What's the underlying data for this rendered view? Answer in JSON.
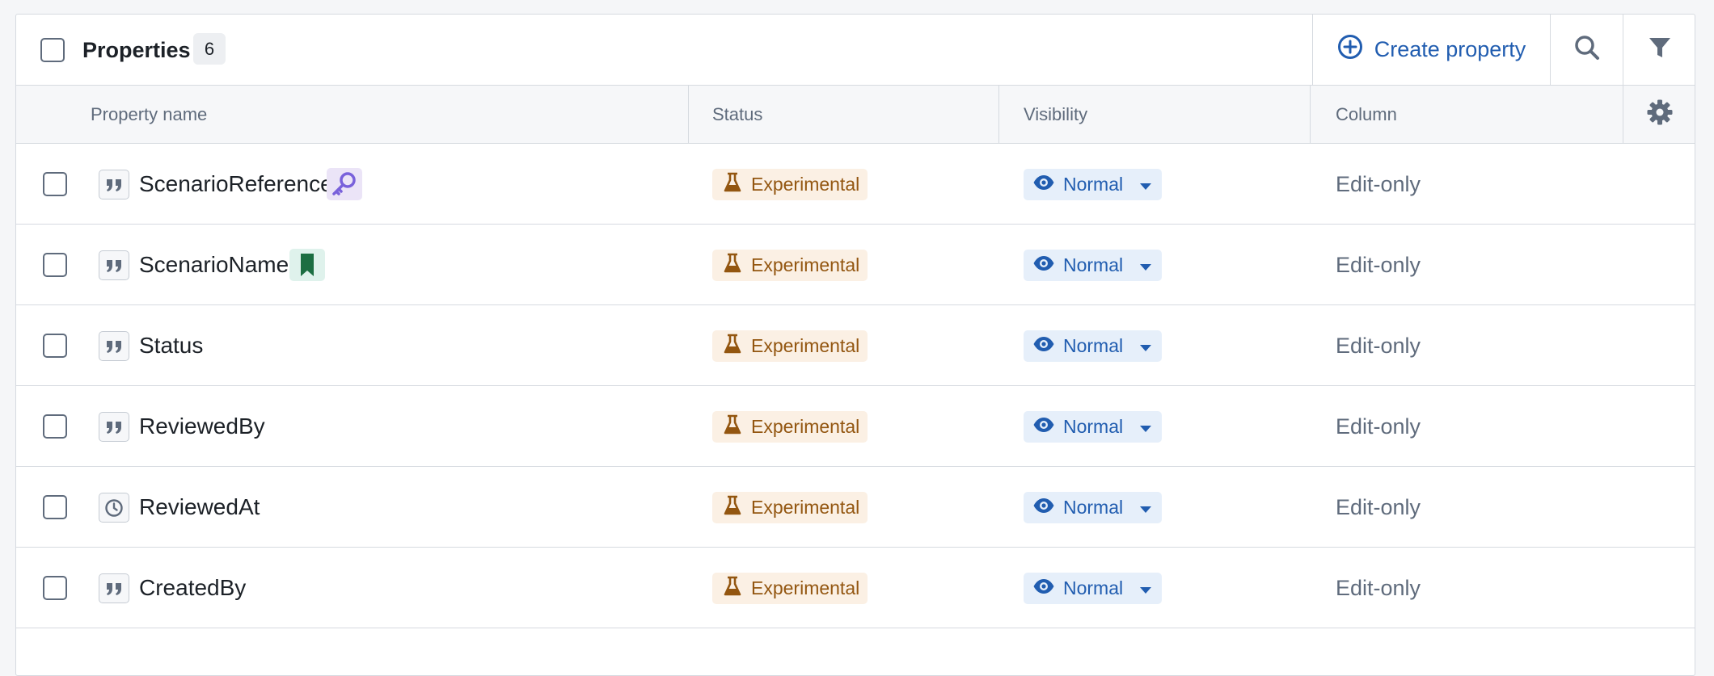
{
  "toolbar": {
    "title": "Properties",
    "count": "6",
    "create_label": "Create property",
    "search_icon": "search-icon",
    "filter_icon": "filter-icon"
  },
  "columns": {
    "name": "Property name",
    "status": "Status",
    "visibility": "Visibility",
    "column": "Column",
    "settings_icon": "gear-icon"
  },
  "colors": {
    "accent": "#215db0",
    "status_bg": "#fbf0e4",
    "status_fg": "#935610",
    "visibility_bg": "#e6effa",
    "primary_key_bg": "#ebe4f7",
    "primary_key_fg": "#7961db",
    "title_key_bg": "#dff2ec",
    "title_key_fg": "#1c6e42"
  },
  "rows": [
    {
      "name": "ScenarioReference",
      "type_icon": "string-quote-icon",
      "extra_icon": "key-icon",
      "status": "Experimental",
      "visibility": "Normal",
      "column": "Edit-only"
    },
    {
      "name": "ScenarioName",
      "type_icon": "string-quote-icon",
      "extra_icon": "bookmark-icon",
      "status": "Experimental",
      "visibility": "Normal",
      "column": "Edit-only"
    },
    {
      "name": "Status",
      "type_icon": "string-quote-icon",
      "extra_icon": "",
      "status": "Experimental",
      "visibility": "Normal",
      "column": "Edit-only"
    },
    {
      "name": "ReviewedBy",
      "type_icon": "string-quote-icon",
      "extra_icon": "",
      "status": "Experimental",
      "visibility": "Normal",
      "column": "Edit-only"
    },
    {
      "name": "ReviewedAt",
      "type_icon": "timestamp-clock-icon",
      "extra_icon": "",
      "status": "Experimental",
      "visibility": "Normal",
      "column": "Edit-only"
    },
    {
      "name": "CreatedBy",
      "type_icon": "string-quote-icon",
      "extra_icon": "",
      "status": "Experimental",
      "visibility": "Normal",
      "column": "Edit-only"
    }
  ]
}
